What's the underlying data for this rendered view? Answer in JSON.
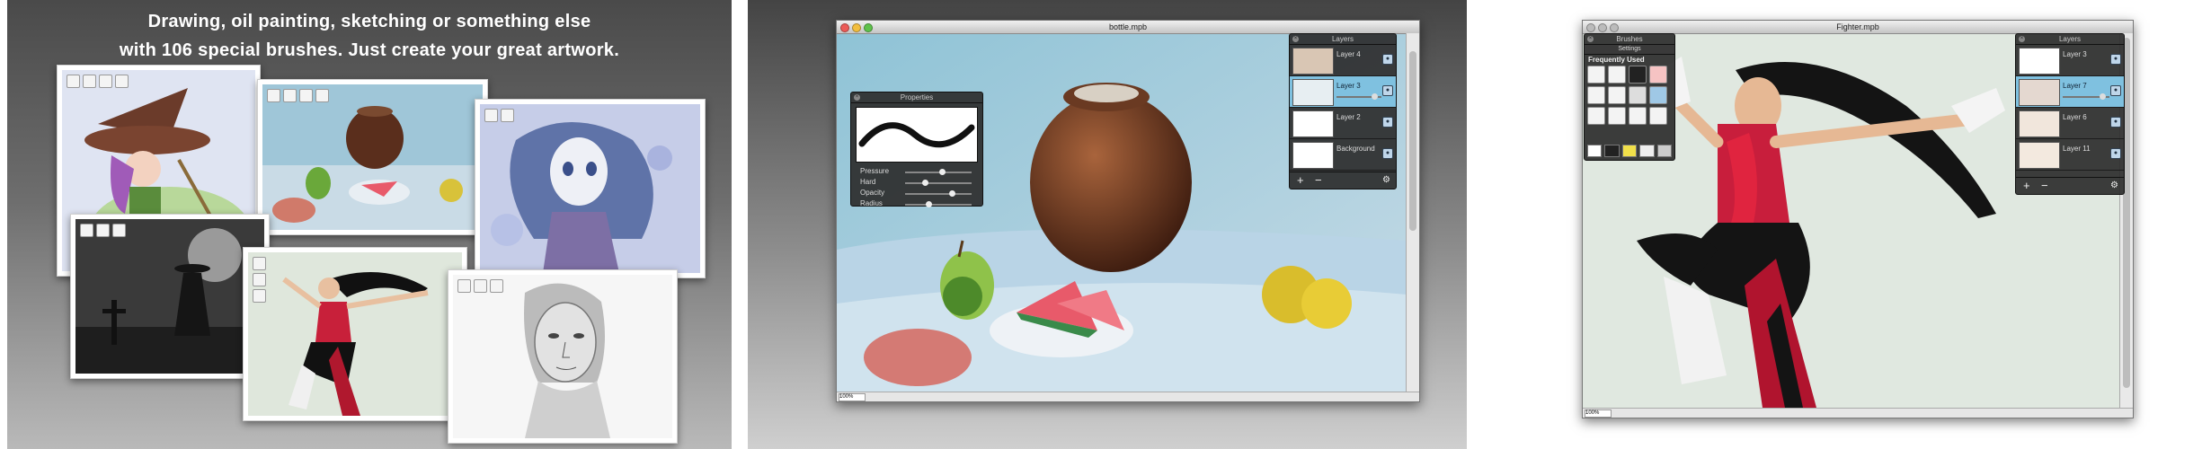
{
  "panel1": {
    "headline_line1": "Drawing, oil painting, sketching or something else",
    "headline_line2": "with 106 special brushes.  Just create your great artwork."
  },
  "window_bottle": {
    "title": "bottle.mpb",
    "zoom_value": "100%",
    "properties": {
      "title": "Properties",
      "labels": [
        "Pressure",
        "Hard",
        "Opacity",
        "Radius"
      ],
      "values": [
        0.55,
        0.3,
        0.7,
        0.35
      ]
    },
    "layers": {
      "title": "Layers",
      "items": [
        "Layer 4",
        "Layer 3",
        "Layer 2",
        "Background"
      ],
      "selected_index": 1,
      "add_label": "+",
      "remove_label": "−",
      "settings_label": "⚙"
    }
  },
  "window_fighter": {
    "title": "Fighter.mpb",
    "zoom_value": "100%",
    "brushes_panel": {
      "title": "Brushes",
      "tab_label": "Settings",
      "section_label": "Frequently Used"
    },
    "layers": {
      "title": "Layers",
      "items": [
        "Layer 3",
        "Layer 7",
        "Layer 6",
        "Layer 11"
      ],
      "selected_index": 1,
      "add_label": "+",
      "remove_label": "−",
      "settings_label": "⚙"
    }
  },
  "colors": {
    "layer_selected": "#7fc1e0",
    "hud_background": "#2c2c2c",
    "traffic_red": "#ec5b57",
    "traffic_yellow": "#f2be3e",
    "traffic_green": "#5fc24b"
  },
  "icons": [
    "close-icon",
    "gear-icon",
    "eye-icon",
    "brush-icon",
    "plus-icon",
    "minus-icon"
  ]
}
